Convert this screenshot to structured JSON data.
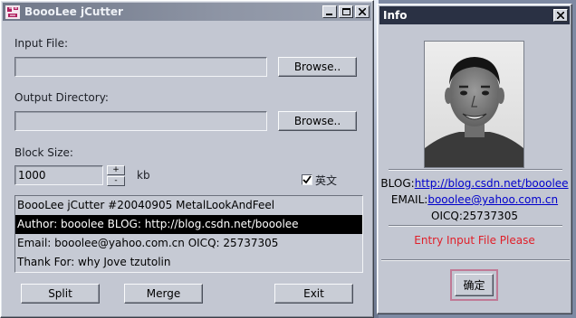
{
  "main_window": {
    "title": "BoooLee jCutter",
    "input_file": {
      "label": "Input File:",
      "value": "",
      "browse_label": "Browse.."
    },
    "output_dir": {
      "label": "Output Directory:",
      "value": "",
      "browse_label": "Browse.."
    },
    "block_size": {
      "label": "Block Size:",
      "value": "1000",
      "unit": "kb",
      "plus": "+",
      "minus": "-"
    },
    "english_checkbox": {
      "label": "英文",
      "checked": true
    },
    "info_list": [
      "BoooLee jCutter #20040905 MetalLookAndFeel",
      "Author: booolee  BLOG: http://blog.csdn.net/booolee",
      "Email: booolee@yahoo.com.cn  OICQ: 25737305",
      "Thank For: why Jove tzutolin"
    ],
    "selected_index": 1,
    "buttons": {
      "split": "Split",
      "merge": "Merge",
      "exit": "Exit"
    }
  },
  "info_window": {
    "title": "Info",
    "blog_label": "BLOG:",
    "blog_url": "http://blog.csdn.net/booolee",
    "email_label": "EMAIL:",
    "email": "booolee@yahoo.com.cn",
    "oicq": "OICQ:25737305",
    "message": "Entry Input File Please",
    "message_color": "#e0202a",
    "ok_label": "确定"
  },
  "icons": [
    "app-icon",
    "minimize-icon",
    "maximize-icon",
    "close-icon",
    "checkmark-icon",
    "portrait-photo"
  ]
}
